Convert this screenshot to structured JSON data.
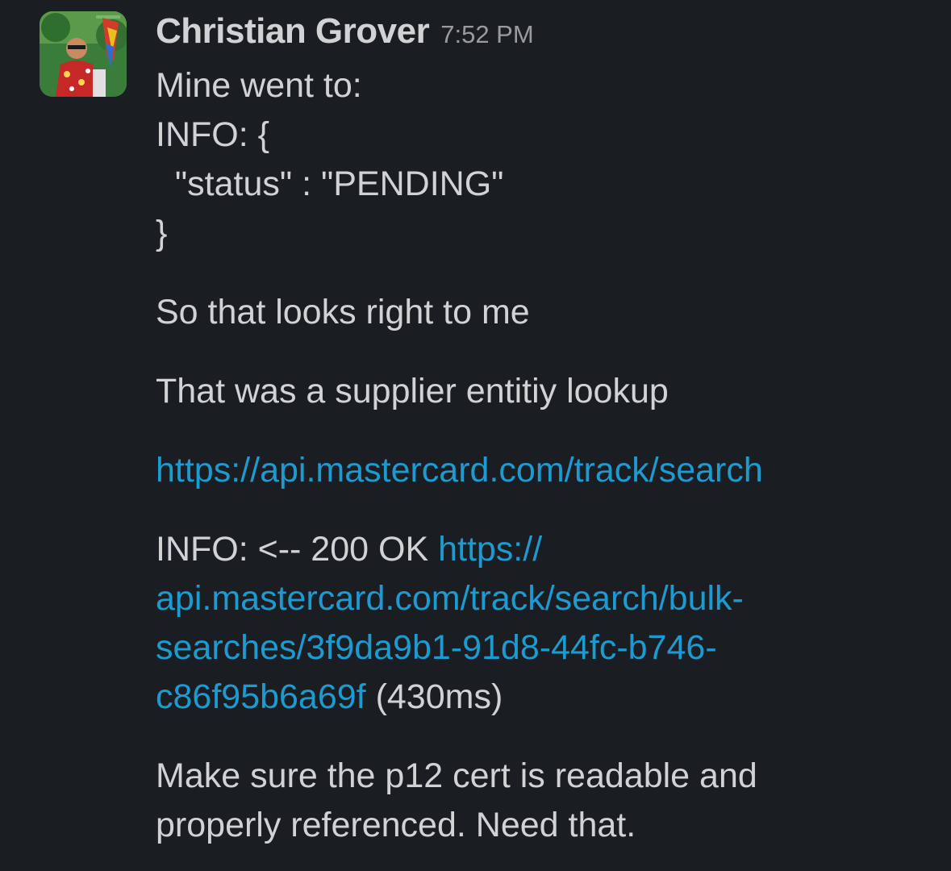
{
  "message": {
    "author": "Christian Grover",
    "timestamp": "7:52 PM",
    "code_lines": [
      "Mine went to:",
      "INFO: {",
      "  \"status\" : \"PENDING\"",
      "}"
    ],
    "para1": "So that looks right to me",
    "para2": "That was a supplier entitiy lookup",
    "link1": "https://api.mastercard.com/track/search",
    "info_prefix": "INFO: <-- 200 OK ",
    "link2_line1": "https://",
    "link2_line2": "api.mastercard.com/track/search/bulk-",
    "link2_line3": "searches/3f9da9b1-91d8-44fc-b746-",
    "link2_line4": "c86f95b6a69f",
    "info_suffix": " (430ms)",
    "para_last_line1": "Make sure the p12 cert is readable and",
    "para_last_line2": "properly referenced. Need that."
  },
  "colors": {
    "background": "#1a1d21",
    "text": "#d1d2d3",
    "link": "#1d9bd1",
    "timestamp": "#9a9b9e"
  },
  "icons": {
    "avatar": "user-avatar-photo"
  }
}
